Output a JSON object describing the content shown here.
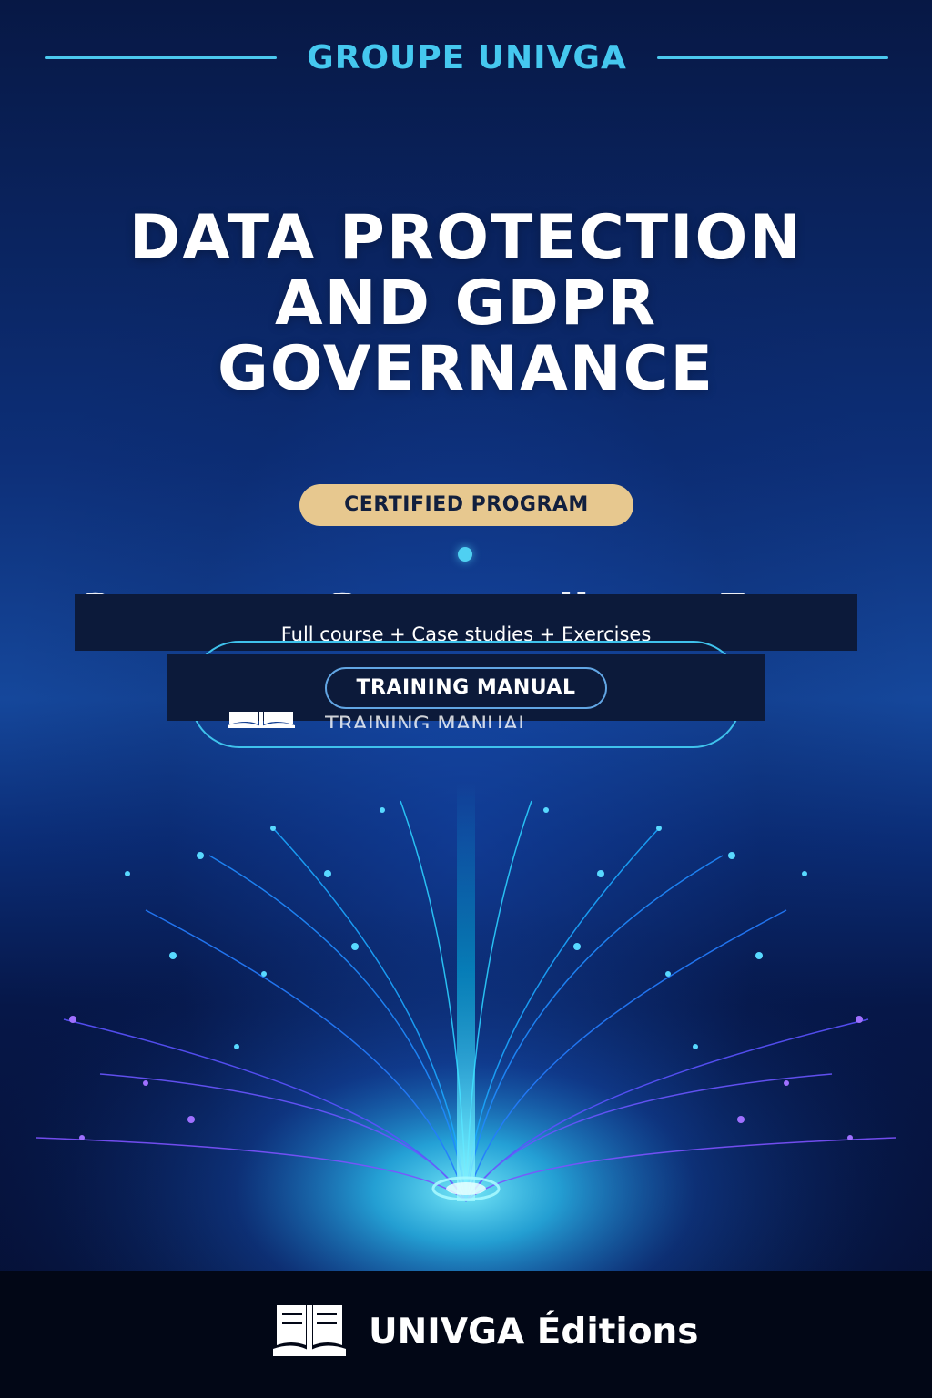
{
  "brand_top": "GROUPE UNIVGA",
  "title_lines": [
    "DATA PROTECTION",
    "AND GDPR",
    "GOVERNANCE"
  ],
  "badge_label": "CERTIFIED PROGRAM",
  "ghost_subtitle": "Course + Case studies + Exercises",
  "subtitle": "Full course + Case studies + Exercises",
  "manual_label": "TRAINING MANUAL",
  "ghost_manual": "TRAINING MANUAL",
  "footer_brand": "UNIVGA Éditions",
  "colors": {
    "brand": "#45c8ef",
    "badge": "#e7c88f",
    "accent": "#4fd0f2",
    "footer_bg": "#020716"
  },
  "icons": {
    "manual_book": "open-book-icon",
    "footer_book": "open-book-icon"
  }
}
